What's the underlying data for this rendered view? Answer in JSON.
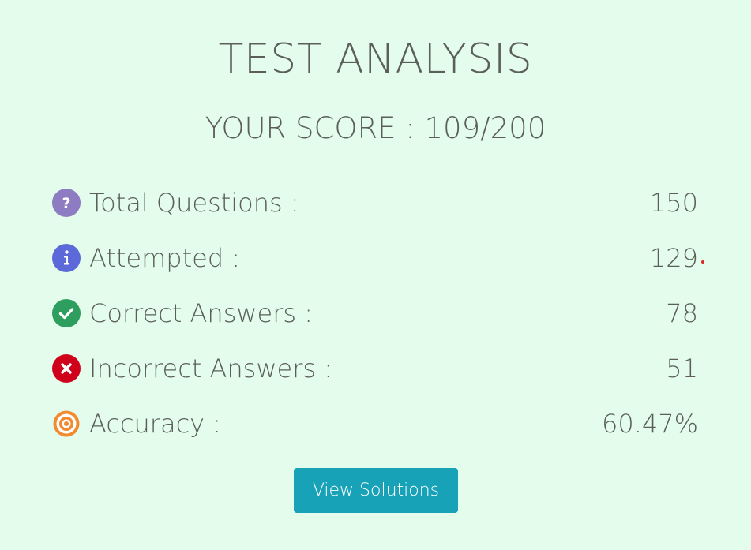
{
  "title": "TEST ANALYSIS",
  "score_label": "YOUR SCORE : 109/200",
  "stats": [
    {
      "label": "Total Questions :",
      "value": "150",
      "icon": "question-circle-icon",
      "color": "#8e7cc3"
    },
    {
      "label": "Attempted :",
      "value": "129",
      "icon": "info-circle-icon",
      "color": "#5b6ad8"
    },
    {
      "label": "Correct Answers :",
      "value": "78",
      "icon": "check-circle-icon",
      "color": "#2e9e5e"
    },
    {
      "label": "Incorrect Answers :",
      "value": "51",
      "icon": "x-circle-icon",
      "color": "#d0021b"
    },
    {
      "label": "Accuracy :",
      "value": "60.47%",
      "icon": "target-icon",
      "color": "#f28b30"
    }
  ],
  "button_label": "View Solutions",
  "colors": {
    "background": "#e3fcec",
    "text": "#5b5f58",
    "button": "#17a2b8"
  }
}
